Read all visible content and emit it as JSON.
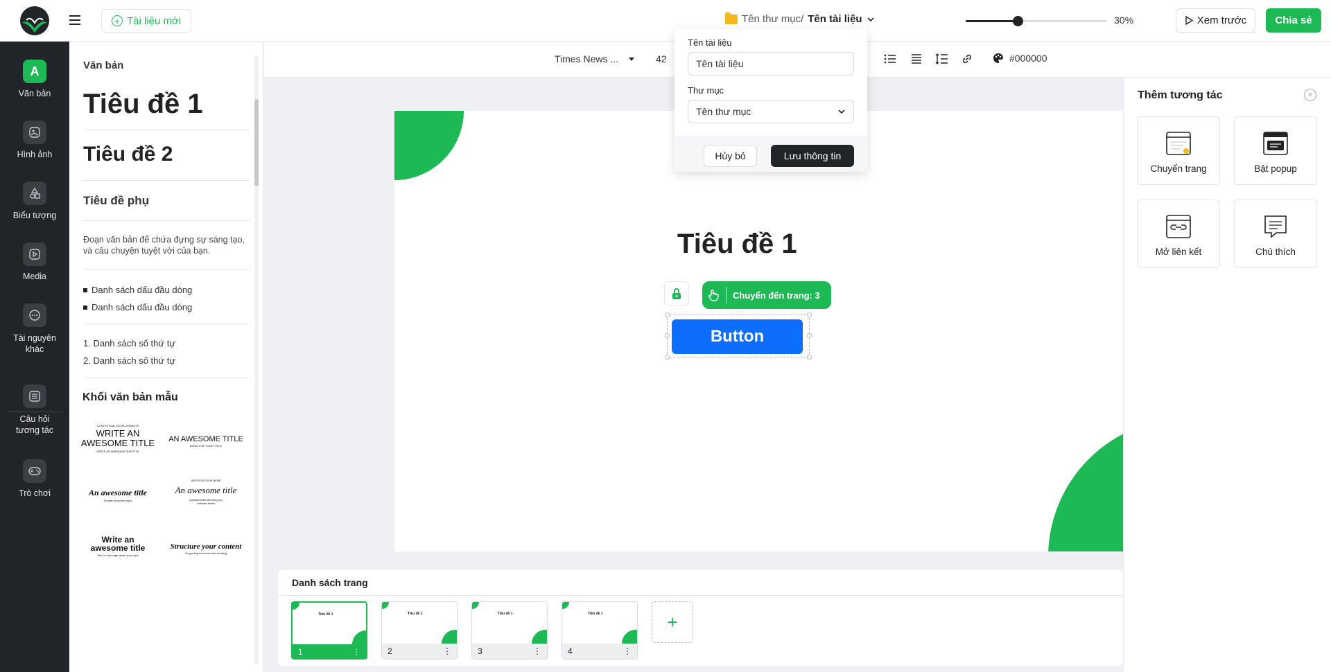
{
  "header": {
    "new_doc_label": "Tài liệu mới",
    "breadcrumb_folder": "Tên thư mục/",
    "breadcrumb_doc": "Tên tài liệu",
    "zoom_percent": 30,
    "zoom_label": "30%",
    "preview_label": "Xem trước",
    "share_label": "Chia sẻ"
  },
  "nav": {
    "items": [
      {
        "label": "Văn bản",
        "icon": "A"
      },
      {
        "label": "Hình ảnh",
        "icon": "image-icon"
      },
      {
        "label": "Biểu tượng",
        "icon": "shapes-icon"
      },
      {
        "label": "Media",
        "icon": "media-icon"
      },
      {
        "label": "Tài nguyên khác",
        "icon": "more-resources-icon"
      },
      {
        "label": "Câu hỏi tương tác",
        "icon": "quiz-icon"
      },
      {
        "label": "Trò chơi",
        "icon": "gamepad-icon"
      }
    ]
  },
  "text_panel": {
    "title": "Văn bản",
    "h1": "Tiêu đề 1",
    "h2": "Tiêu đề 2",
    "sub": "Tiêu đề phụ",
    "para": "Đoạn văn bản để chứa đựng sự sáng tạo, và câu chuyện tuyệt vời của bạn.",
    "bullets": [
      "Danh sách dấu đầu dòng",
      "Danh sách dấu đầu dòng"
    ],
    "numbered": [
      "1. Danh sách số thứ tự",
      "2. Danh sách số thứ tự"
    ],
    "blocks_title": "Khối văn bản mẫu",
    "templates": [
      {
        "pre": "CONTEXTUAL DEVELOPMENTS",
        "main": "WRITE AN AWESOME TITLE",
        "post": "WRITE AN AWESOME SUBTITLE"
      },
      {
        "main": "AN AWESOME TITLE",
        "post": "IDEAS FOR YOUR TITLE"
      },
      {
        "main": "An awesome title",
        "post": "Subtitle about the topic"
      },
      {
        "pre": "INTRODUCTION HERE",
        "main": "An awesome title",
        "post": "Questions like this help you consider better"
      },
      {
        "main": "Write an awesome title",
        "post": "Text on this page about your topic"
      },
      {
        "main": "Structure your content",
        "post": "Supporting text under the heading"
      }
    ]
  },
  "toolbar": {
    "font_name": "Times News ...",
    "font_size": "42",
    "color_value": "#000000"
  },
  "canvas": {
    "title": "Tiêu đề 1",
    "goto_label": "Chuyển đến trang: 3",
    "button_label": "Button"
  },
  "popover": {
    "doc_name_label": "Tên tài liệu",
    "doc_name_value": "Tên tài liệu",
    "folder_label": "Thư mục",
    "folder_value": "Tên thư mục",
    "cancel_label": "Hủy bỏ",
    "save_label": "Lưu thông tin"
  },
  "right_panel": {
    "title": "Thêm tương tác",
    "cards": [
      "Chuyển trang",
      "Bật popup",
      "Mở liên kết",
      "Chú thích"
    ]
  },
  "pages": {
    "title": "Danh sách trang",
    "items": [
      {
        "number": "1",
        "thumb_title": "Tiêu đề 1"
      },
      {
        "number": "2",
        "thumb_title": "Tiêu đề 1"
      },
      {
        "number": "3",
        "thumb_title": "Tiêu đề 1"
      },
      {
        "number": "4",
        "thumb_title": "Tiêu đề 1"
      }
    ],
    "add_label": "+"
  },
  "colors": {
    "accent": "#1db954",
    "dark": "#212529",
    "button_blue": "#0d6efd"
  }
}
